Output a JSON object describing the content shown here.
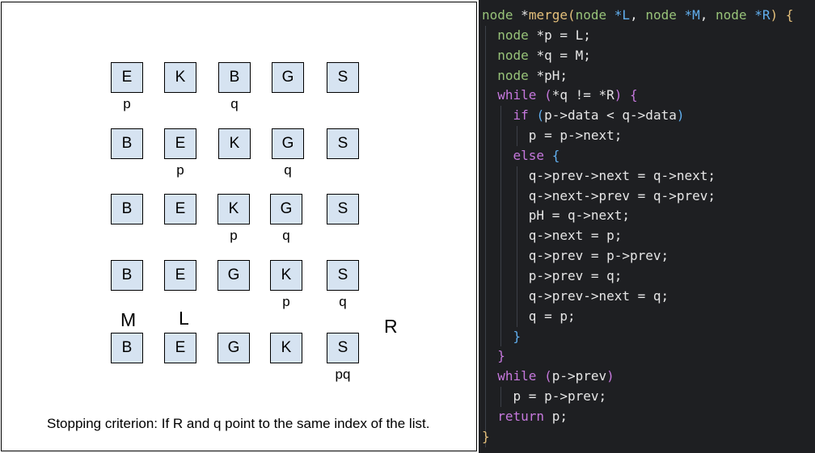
{
  "diagram": {
    "rows": [
      {
        "boxes": [
          "E",
          "K",
          "B",
          "G",
          "S"
        ],
        "pointers": [
          {
            "text": "p",
            "under": 0
          },
          {
            "text": "q",
            "under": 2
          }
        ]
      },
      {
        "boxes": [
          "B",
          "E",
          "K",
          "G",
          "S"
        ],
        "pointers": [
          {
            "text": "p",
            "under": 1
          },
          {
            "text": "q",
            "under": 3
          }
        ]
      },
      {
        "boxes": [
          "B",
          "E",
          "K",
          "G",
          "S"
        ],
        "pointers": [
          {
            "text": "p",
            "under": 2
          },
          {
            "text": "q",
            "under": 3
          }
        ]
      },
      {
        "boxes": [
          "B",
          "E",
          "G",
          "K",
          "S"
        ],
        "pointers": [
          {
            "text": "p",
            "under": 3
          },
          {
            "text": "q",
            "under": 4
          }
        ]
      },
      {
        "boxes": [
          "B",
          "E",
          "G",
          "K",
          "S"
        ],
        "pointers": [
          {
            "text": "pq",
            "under": 4
          }
        ]
      }
    ],
    "labels": {
      "m": "M",
      "l": "L",
      "r": "R"
    },
    "caption": "Stopping criterion: If R and q point to the same index of the list."
  },
  "code": {
    "colors": {
      "keyword": "#c678dd",
      "type": "#98c379",
      "func": "#e5c07b",
      "plain": "#e6e6e6",
      "paren": "#61afef",
      "bg": "#1e1f22"
    },
    "lines": [
      {
        "indent": 0,
        "tokens": [
          [
            "type",
            "node "
          ],
          [
            "plain",
            "*"
          ],
          [
            "func",
            "merge"
          ],
          [
            "func",
            "("
          ],
          [
            "type",
            "node "
          ],
          [
            "paren",
            "*L"
          ],
          [
            "plain",
            ", "
          ],
          [
            "type",
            "node "
          ],
          [
            "paren",
            "*M"
          ],
          [
            "plain",
            ", "
          ],
          [
            "type",
            "node "
          ],
          [
            "paren",
            "*R"
          ],
          [
            "func",
            ") {"
          ]
        ]
      },
      {
        "indent": 1,
        "tokens": [
          [
            "type",
            "node "
          ],
          [
            "plain",
            "*p = L;"
          ]
        ]
      },
      {
        "indent": 1,
        "tokens": [
          [
            "type",
            "node "
          ],
          [
            "plain",
            "*q = M;"
          ]
        ]
      },
      {
        "indent": 1,
        "tokens": [
          [
            "type",
            "node "
          ],
          [
            "plain",
            "*pH;"
          ]
        ]
      },
      {
        "indent": 1,
        "tokens": [
          [
            "keyword",
            "while "
          ],
          [
            "keyword",
            "("
          ],
          [
            "plain",
            "*q != *R"
          ],
          [
            "keyword",
            ")"
          ],
          [
            "keyword",
            " {"
          ]
        ]
      },
      {
        "indent": 2,
        "tokens": [
          [
            "keyword",
            "if "
          ],
          [
            "paren",
            "("
          ],
          [
            "plain",
            "p->data < q->data"
          ],
          [
            "paren",
            ")"
          ]
        ]
      },
      {
        "indent": 3,
        "tokens": [
          [
            "plain",
            "p = p->next;"
          ]
        ]
      },
      {
        "indent": 2,
        "tokens": [
          [
            "keyword",
            "else "
          ],
          [
            "paren",
            "{"
          ]
        ]
      },
      {
        "indent": 3,
        "tokens": [
          [
            "plain",
            "q->prev->next = q->next;"
          ]
        ]
      },
      {
        "indent": 3,
        "tokens": [
          [
            "plain",
            "q->next->prev = q->prev;"
          ]
        ]
      },
      {
        "indent": 3,
        "tokens": [
          [
            "plain",
            "pH = q->next;"
          ]
        ]
      },
      {
        "indent": 3,
        "tokens": [
          [
            "plain",
            "q->next = p;"
          ]
        ]
      },
      {
        "indent": 3,
        "tokens": [
          [
            "plain",
            "q->prev = p->prev;"
          ]
        ]
      },
      {
        "indent": 3,
        "tokens": [
          [
            "plain",
            "p->prev = q;"
          ]
        ]
      },
      {
        "indent": 3,
        "tokens": [
          [
            "plain",
            "q->prev->next = q;"
          ]
        ]
      },
      {
        "indent": 3,
        "tokens": [
          [
            "plain",
            "q = p;"
          ]
        ]
      },
      {
        "indent": 2,
        "tokens": [
          [
            "paren",
            "}"
          ]
        ]
      },
      {
        "indent": 1,
        "tokens": [
          [
            "keyword",
            "}"
          ]
        ]
      },
      {
        "indent": 1,
        "tokens": [
          [
            "keyword",
            "while "
          ],
          [
            "keyword",
            "("
          ],
          [
            "plain",
            "p->prev"
          ],
          [
            "keyword",
            ")"
          ]
        ]
      },
      {
        "indent": 2,
        "tokens": [
          [
            "plain",
            "p = p->prev;"
          ]
        ]
      },
      {
        "indent": 1,
        "tokens": [
          [
            "keyword",
            "return "
          ],
          [
            "plain",
            "p;"
          ]
        ]
      },
      {
        "indent": 0,
        "tokens": [
          [
            "func",
            "}"
          ]
        ]
      }
    ]
  }
}
